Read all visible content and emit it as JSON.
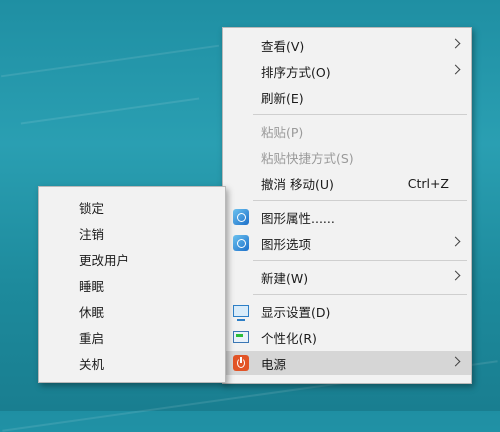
{
  "context_menu": {
    "items": [
      {
        "label": "查看(V)"
      },
      {
        "label": "排序方式(O)"
      },
      {
        "label": "刷新(E)"
      },
      {
        "label": "粘贴(P)"
      },
      {
        "label": "粘贴快捷方式(S)"
      },
      {
        "label": "撤消 移动(U)",
        "shortcut": "Ctrl+Z"
      },
      {
        "label": "图形属性......",
        "icon": "graphics-properties-icon"
      },
      {
        "label": "图形选项",
        "icon": "graphics-options-icon"
      },
      {
        "label": "新建(W)"
      },
      {
        "label": "显示设置(D)",
        "icon": "display-settings-icon"
      },
      {
        "label": "个性化(R)",
        "icon": "personalize-icon"
      },
      {
        "label": "电源",
        "icon": "power-icon"
      }
    ]
  },
  "power_submenu": {
    "items": [
      {
        "label": "锁定"
      },
      {
        "label": "注销"
      },
      {
        "label": "更改用户"
      },
      {
        "label": "睡眠"
      },
      {
        "label": "休眠"
      },
      {
        "label": "重启"
      },
      {
        "label": "关机"
      }
    ]
  },
  "colors": {
    "desktop_background": "#1f8fa3",
    "menu_background": "#f2f2f2",
    "highlight": "#d6d6d6",
    "disabled_text": "#9a9a9a"
  }
}
